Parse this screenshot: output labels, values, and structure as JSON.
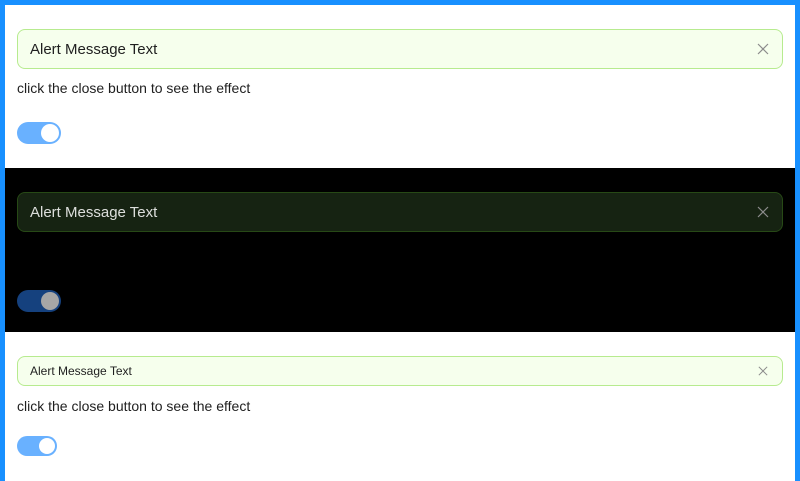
{
  "light_demo": {
    "alert_message": "Alert Message Text",
    "hint": "click the close button to see the effect",
    "switch_on": true
  },
  "dark_demo": {
    "alert_message": "Alert Message Text",
    "switch_on": true
  },
  "compact_demo": {
    "alert_message": "Alert Message Text",
    "hint": "click the close button to see the effect",
    "switch_on": true
  },
  "colors": {
    "frame_border": "#1890ff",
    "success_bg": "#f6ffed",
    "success_border": "#b7eb8f",
    "dark_success_bg": "#162312",
    "dark_success_border": "#274916",
    "switch_light": "#69b1ff",
    "switch_dark": "#15417e"
  },
  "icons": {
    "close": "close-icon"
  }
}
